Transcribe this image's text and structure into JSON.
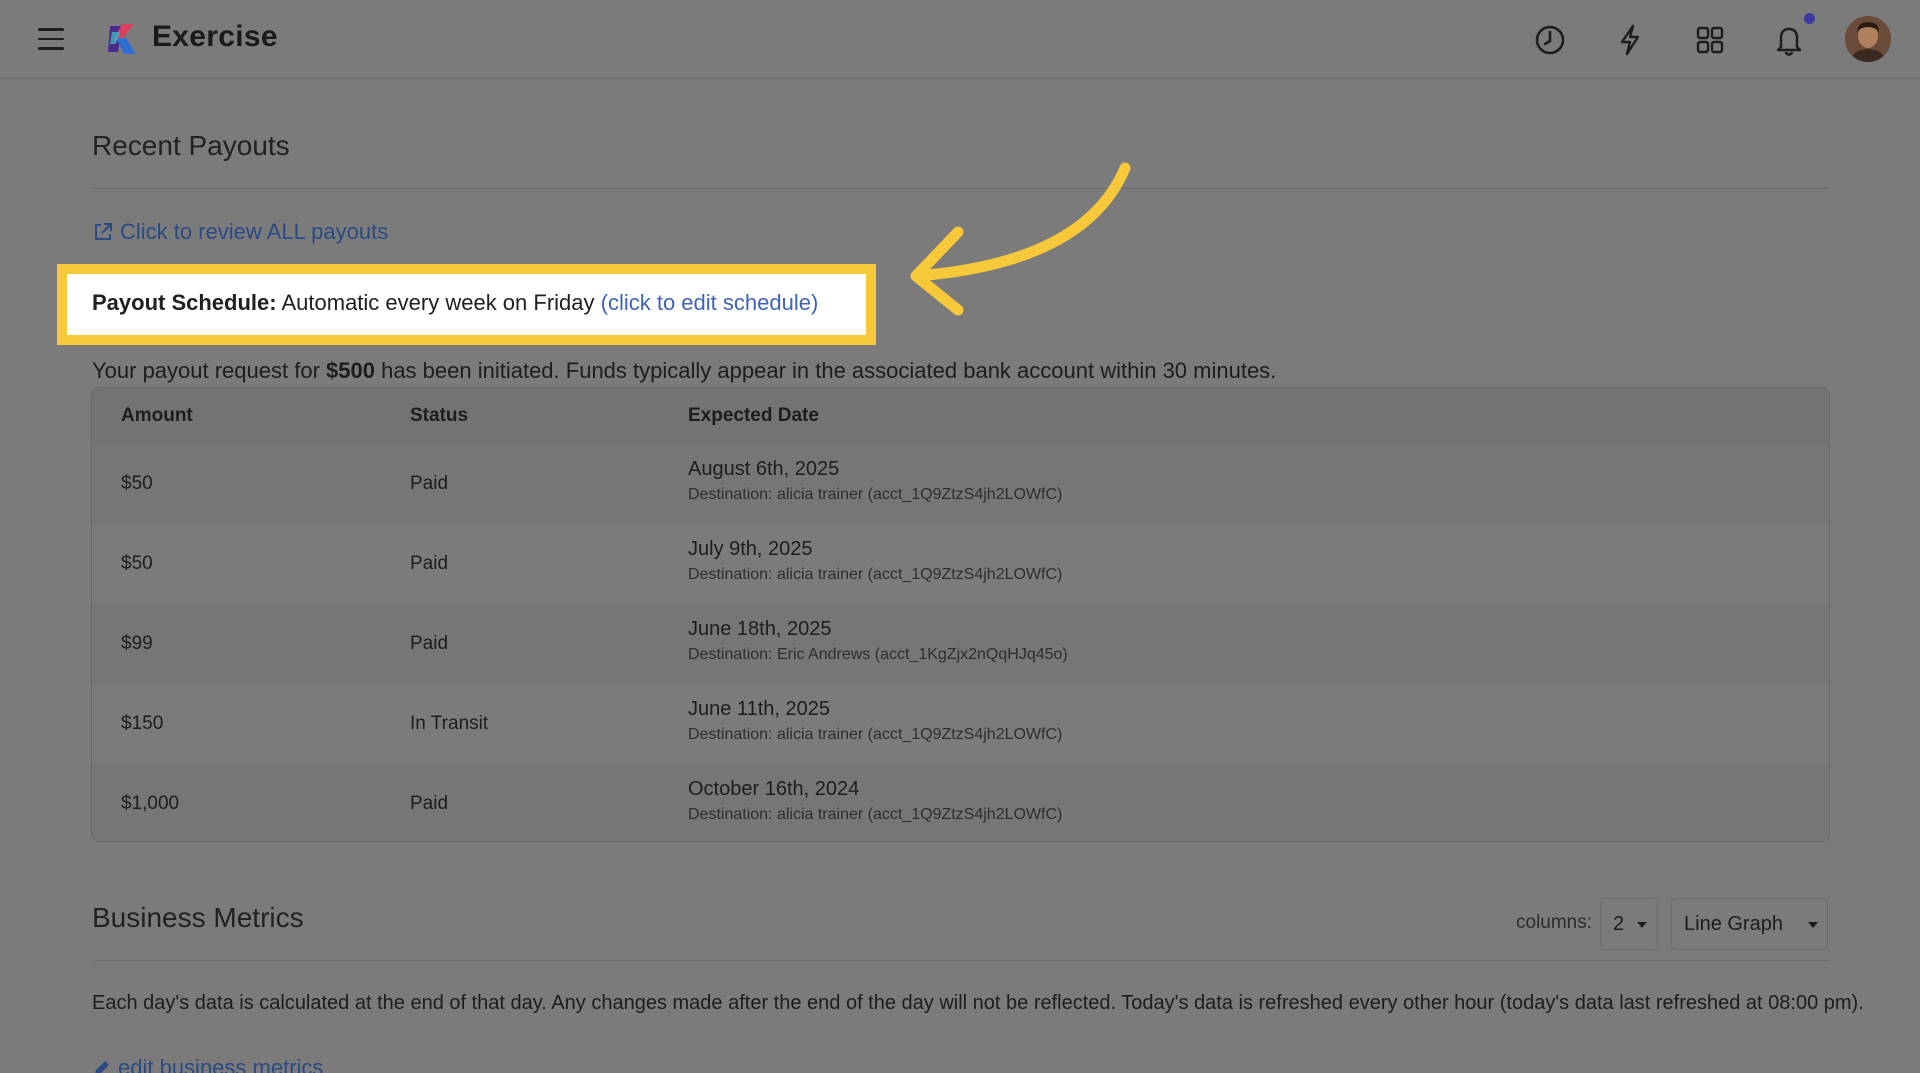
{
  "header": {
    "app_title": "Exercise",
    "icons": [
      "history-icon",
      "lightning-icon",
      "apps-grid-icon",
      "bell-icon"
    ],
    "accent_dot_color": "#3b3aa0"
  },
  "payouts": {
    "title": "Recent Payouts",
    "review_link": "Click to review ALL payouts",
    "schedule_label": "Payout Schedule:",
    "schedule_value": " Automatic every week on Friday ",
    "schedule_edit_link": "(click to edit schedule)",
    "initiated_prefix": "Your payout request for ",
    "initiated_amount": "$500",
    "initiated_suffix": " has been initiated. Funds typically appear in the associated bank account within 30 minutes.",
    "columns": [
      "Amount",
      "Status",
      "Expected Date"
    ],
    "rows": [
      {
        "amount": "$50",
        "status": "Paid",
        "date": "August 6th, 2025",
        "destination": "Destination: alicia trainer (acct_1Q9ZtzS4jh2LOWfC)"
      },
      {
        "amount": "$50",
        "status": "Paid",
        "date": "July 9th, 2025",
        "destination": "Destination: alicia trainer (acct_1Q9ZtzS4jh2LOWfC)"
      },
      {
        "amount": "$99",
        "status": "Paid",
        "date": "June 18th, 2025",
        "destination": "Destination: Eric Andrews (acct_1KgZjx2nQqHJq45o)"
      },
      {
        "amount": "$150",
        "status": "In Transit",
        "date": "June 11th, 2025",
        "destination": "Destination: alicia trainer (acct_1Q9ZtzS4jh2LOWfC)"
      },
      {
        "amount": "$1,000",
        "status": "Paid",
        "date": "October 16th, 2024",
        "destination": "Destination: alicia trainer (acct_1Q9ZtzS4jh2LOWfC)"
      }
    ]
  },
  "metrics": {
    "title": "Business Metrics",
    "columns_label": "columns:",
    "columns_value": "2",
    "chart_type_value": "Line Graph",
    "note": "Each day's data is calculated at the end of that day. Any changes made after the end of the day will not be reflected. Today's data is refreshed every other hour (today's data last refreshed at 08:00 pm).",
    "edit_link": "edit business metrics"
  },
  "annotation": {
    "highlight_color": "#f7c83a"
  }
}
